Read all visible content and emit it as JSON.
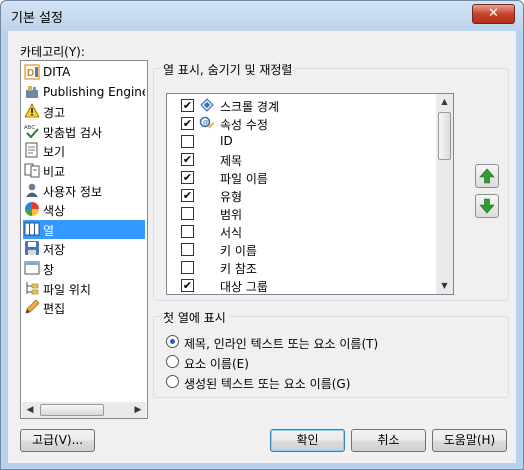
{
  "window": {
    "title": "기본 설정",
    "close_label": "✕"
  },
  "category": {
    "label": "카테고리(Y):",
    "items": [
      {
        "label": "DITA",
        "icon": "dita-icon"
      },
      {
        "label": "Publishing Engine",
        "icon": "publishing-engine-icon"
      },
      {
        "label": "경고",
        "icon": "warning-icon"
      },
      {
        "label": "맞춤법 검사",
        "icon": "spellcheck-icon"
      },
      {
        "label": "보기",
        "icon": "view-icon"
      },
      {
        "label": "비교",
        "icon": "compare-icon"
      },
      {
        "label": "사용자 정보",
        "icon": "user-icon"
      },
      {
        "label": "색상",
        "icon": "color-icon"
      },
      {
        "label": "열",
        "icon": "columns-icon",
        "selected": true
      },
      {
        "label": "저장",
        "icon": "save-icon"
      },
      {
        "label": "창",
        "icon": "window-icon"
      },
      {
        "label": "파일 위치",
        "icon": "file-location-icon"
      },
      {
        "label": "편집",
        "icon": "edit-icon"
      }
    ],
    "scroll_left": "◀",
    "scroll_right": "▶"
  },
  "columns_group": {
    "title": "열 표시, 숨기기 및 재정렬",
    "items": [
      {
        "label": "스크롤 경계",
        "checked": true,
        "icon": "scroll-boundary-icon"
      },
      {
        "label": "속성 수정",
        "checked": true,
        "icon": "attribute-edit-icon"
      },
      {
        "label": "ID",
        "checked": false
      },
      {
        "label": "제목",
        "checked": true
      },
      {
        "label": "파일 이름",
        "checked": true
      },
      {
        "label": "유형",
        "checked": true
      },
      {
        "label": "범위",
        "checked": false
      },
      {
        "label": "서식",
        "checked": false
      },
      {
        "label": "키 이름",
        "checked": false
      },
      {
        "label": "키 참조",
        "checked": false
      },
      {
        "label": "대상 그룹",
        "checked": true
      }
    ],
    "check_mark": "✔",
    "scroll_up": "▲",
    "scroll_down": "▼"
  },
  "first_column_group": {
    "title": "첫 열에 표시",
    "options": [
      {
        "label": "제목, 인라인 텍스트 또는 요소 이름(T)",
        "selected": true
      },
      {
        "label": "요소 이름(E)",
        "selected": false
      },
      {
        "label": "생성된 텍스트 또는 요소 이름(G)",
        "selected": false
      }
    ]
  },
  "buttons": {
    "advanced": "고급(V)...",
    "ok": "확인",
    "cancel": "취소",
    "help": "도움말(H)"
  },
  "colors": {
    "selection": "#3399ff",
    "arrow_green": "#2e9e2e"
  }
}
